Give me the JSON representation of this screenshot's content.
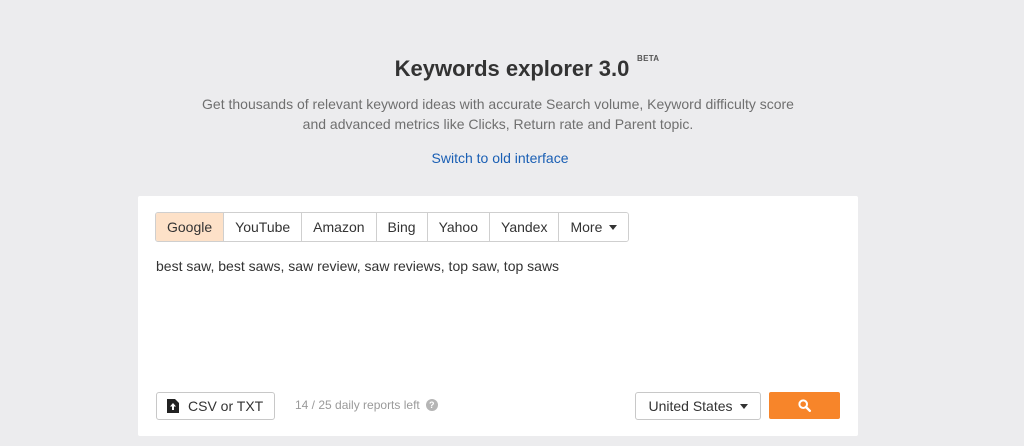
{
  "header": {
    "title": "Keywords explorer 3.0",
    "badge": "BETA",
    "subtitle": "Get thousands of relevant keyword ideas with accurate Search volume, Keyword difficulty score and advanced metrics like Clicks, Return rate and Parent topic.",
    "switch_link": "Switch to old interface"
  },
  "engines": {
    "items": [
      {
        "label": "Google",
        "active": true
      },
      {
        "label": "YouTube",
        "active": false
      },
      {
        "label": "Amazon",
        "active": false
      },
      {
        "label": "Bing",
        "active": false
      },
      {
        "label": "Yahoo",
        "active": false
      },
      {
        "label": "Yandex",
        "active": false
      }
    ],
    "more_label": "More"
  },
  "input": {
    "keywords_value": "best saw, best saws, saw review, saw reviews, top saw, top saws"
  },
  "footer": {
    "upload_label": "CSV or TXT",
    "upload_icon": "upload-file-icon",
    "reports_left": "14 / 25 daily reports left",
    "help_icon": "question-circle-icon",
    "country": "United States",
    "search_icon": "search-icon"
  },
  "colors": {
    "accent": "#f7852a",
    "active_tab": "#fde1c8",
    "link": "#1a5fb4",
    "background": "#ececee"
  }
}
